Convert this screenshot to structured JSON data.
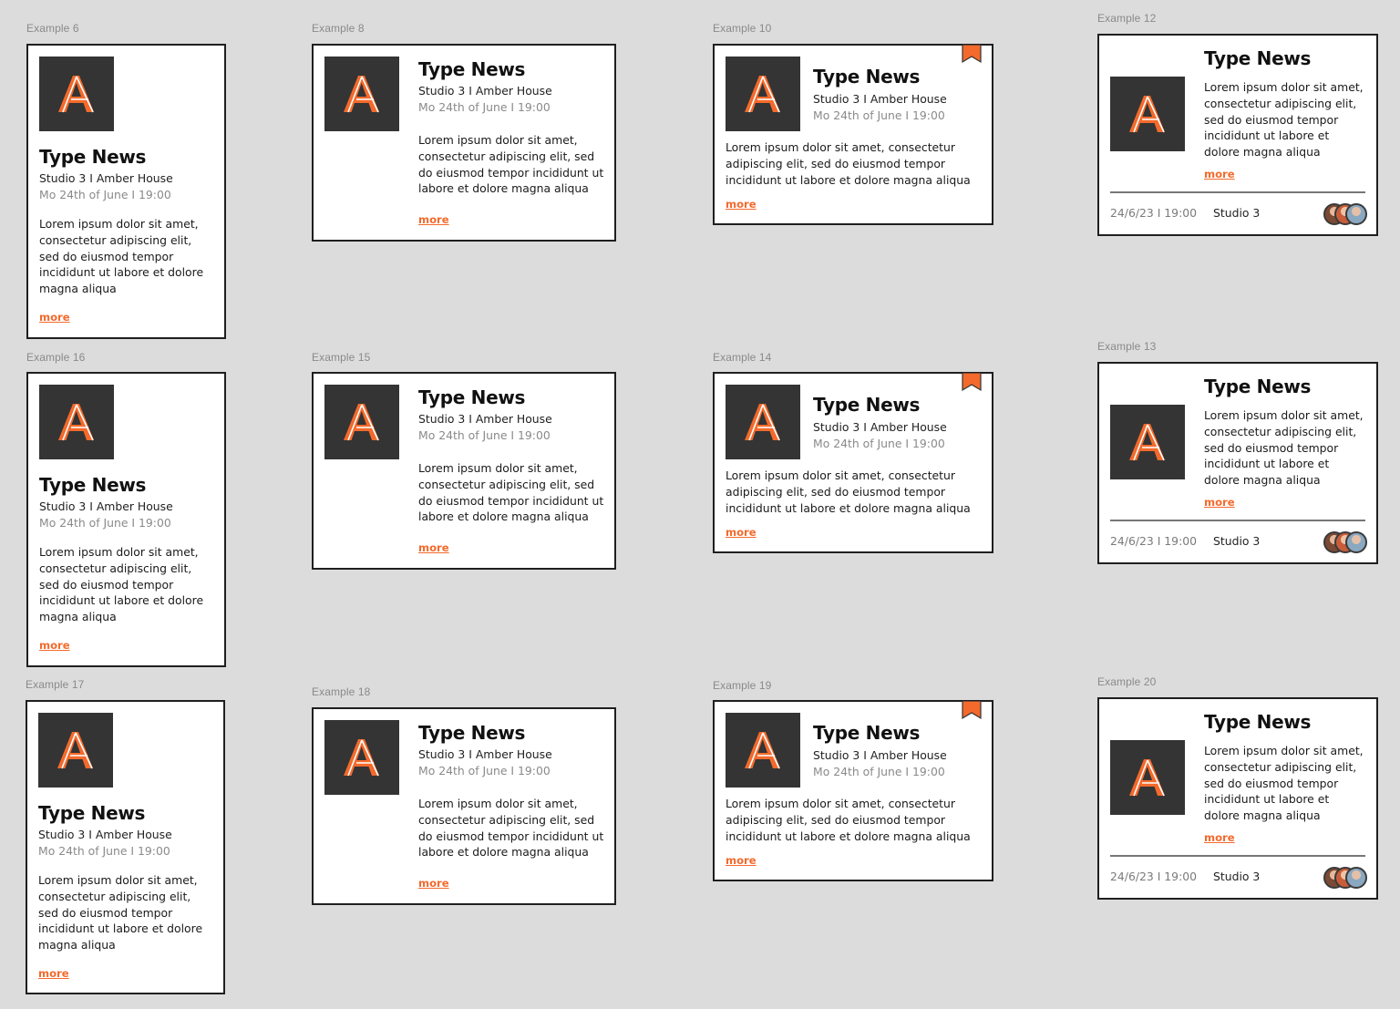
{
  "card_text": {
    "title": "Type News",
    "location": "Studio 3 I Amber House",
    "datetime": "Mo 24th of June I  19:00",
    "body": "Lorem ipsum dolor sit amet, consectetur adipiscing elit, sed do eiusmod tempor incididunt ut labore et dolore magna aliqua",
    "more_label": "more",
    "footer_date": "24/6/23 I  19:00",
    "footer_studio": "Studio 3"
  },
  "colors": {
    "accent": "#f36a2c",
    "logo_bg": "#343434",
    "canvas_bg": "#dcdcdc"
  },
  "icons": {
    "logo": "amber-house-a-logo-icon",
    "bookmark": "bookmark-icon",
    "avatars": "avatar-stack"
  },
  "frames": [
    {
      "label": "Example 6"
    },
    {
      "label": "Example 8"
    },
    {
      "label": "Example 10"
    },
    {
      "label": "Example 12"
    },
    {
      "label": "Example 16"
    },
    {
      "label": "Example 15"
    },
    {
      "label": "Example 14"
    },
    {
      "label": "Example 13"
    },
    {
      "label": "Example 17"
    },
    {
      "label": "Example 18"
    },
    {
      "label": "Example 19"
    },
    {
      "label": "Example 20"
    }
  ]
}
